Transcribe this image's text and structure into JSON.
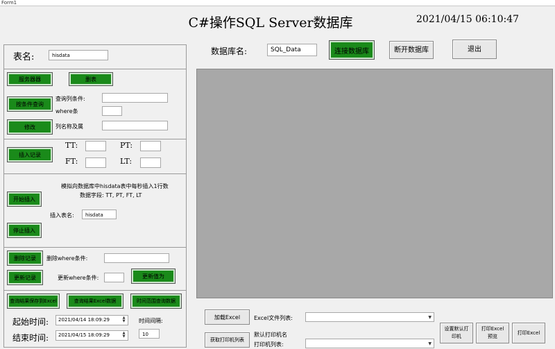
{
  "window": {
    "title": "Form1"
  },
  "header": {
    "title": "C#操作SQL Server数据库",
    "datetime": "2021/04/15 06:10:47"
  },
  "top": {
    "db_label": "数据库名:",
    "db_value": "SQL_Data",
    "connect_button": "连接数据库",
    "disconnect_button": "断开数据库",
    "exit_button": "退出"
  },
  "table": {
    "label": "表名:",
    "value": "hisdata"
  },
  "query": {
    "create_table_button": "服务器器",
    "delete_button": "删表",
    "condition_query_button": "按条件查询",
    "query_column_label": "查询列条件:",
    "where_label": "where条",
    "modify_button": "修改",
    "column_label": "列名称及属"
  },
  "insert": {
    "insert_button": "插入记录",
    "tt_label": "TT:",
    "pt_label": "PT:",
    "ft_label": "FT:",
    "lt_label": "LT:"
  },
  "simulate": {
    "desc1": "模拟向数据库中hisdata表中每秒插入1行数",
    "desc2": "数据字段: TT, PT, FT, LT",
    "start_button": "开始插入",
    "table_label": "插入表名:",
    "table_value": "hisdata",
    "stop_button": "停止插入"
  },
  "delete": {
    "delete_record_button": "删除记录",
    "delete_where_label": "删除where条件:",
    "update_button": "更新记录",
    "update_where_label": "更新where条件:",
    "update_value_button": "更新值为"
  },
  "timequery": {
    "btn1": "查询结果保存到Excel",
    "btn2": "查询结果Excel数据",
    "btn3": "时间范围查询数据",
    "start_label": "起始时间:",
    "start_value": "2021/04/14 18:09:29",
    "end_label": "结束时间:",
    "end_value": "2021/04/15 18:09:29",
    "interval_label": "时间间隔:",
    "interval_value": "10"
  },
  "bottom": {
    "load_excel_button": "加载Excel",
    "excel_list_label": "Excel文件列表:",
    "get_printers_button": "获取打印机列表",
    "default_printer_label": "默认打印机名",
    "printer_list_label": "打印机列表:",
    "set_default_button": "设置默认打印机",
    "print_preview_button": "打印Excel预览",
    "print_button": "打印Excel"
  }
}
